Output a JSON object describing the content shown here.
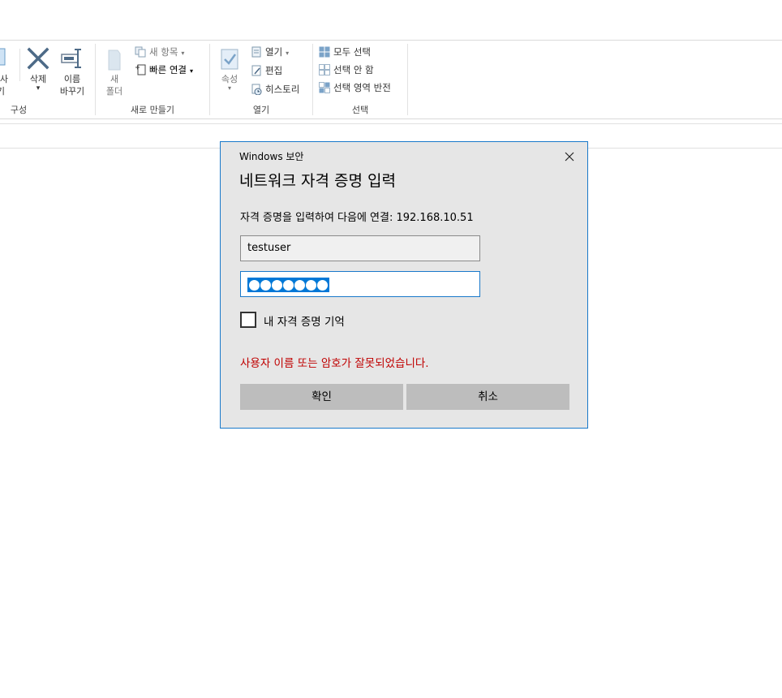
{
  "ribbon": {
    "organize": {
      "label": "구성",
      "partial_top": "사",
      "partial_bottom": "기",
      "delete": {
        "line1": "삭제",
        "arrow": "▾"
      },
      "rename": {
        "line1": "이름",
        "line2": "바꾸기"
      }
    },
    "new": {
      "label": "새로 만들기",
      "new_folder": {
        "line1": "새",
        "line2": "폴더"
      },
      "new_item": "새 항목",
      "easy_access": "빠른 연결"
    },
    "open": {
      "label": "열기",
      "properties": "속성",
      "open": "열기",
      "edit": "편집",
      "history": "히스토리"
    },
    "select": {
      "label": "선택",
      "select_all": "모두 선택",
      "select_none": "선택 안 함",
      "invert": "선택 영역 반전"
    }
  },
  "dialog": {
    "window_title": "Windows 보안",
    "heading": "네트워크 자격 증명 입력",
    "message": "자격 증명을 입력하여 다음에 연결: 192.168.10.51",
    "username_value": "testuser",
    "password_length": 7,
    "remember_label": "내 자격 증명 기억",
    "remember_checked": false,
    "error": "사용자 이름 또는 암호가 잘못되었습니다.",
    "ok_button": "확인",
    "cancel_button": "취소"
  },
  "colors": {
    "accent": "#1979ca",
    "selection": "#0078d7",
    "error": "#c00000",
    "dialog_bg": "#e6e6e6",
    "button_bg": "#bdbdbd"
  }
}
